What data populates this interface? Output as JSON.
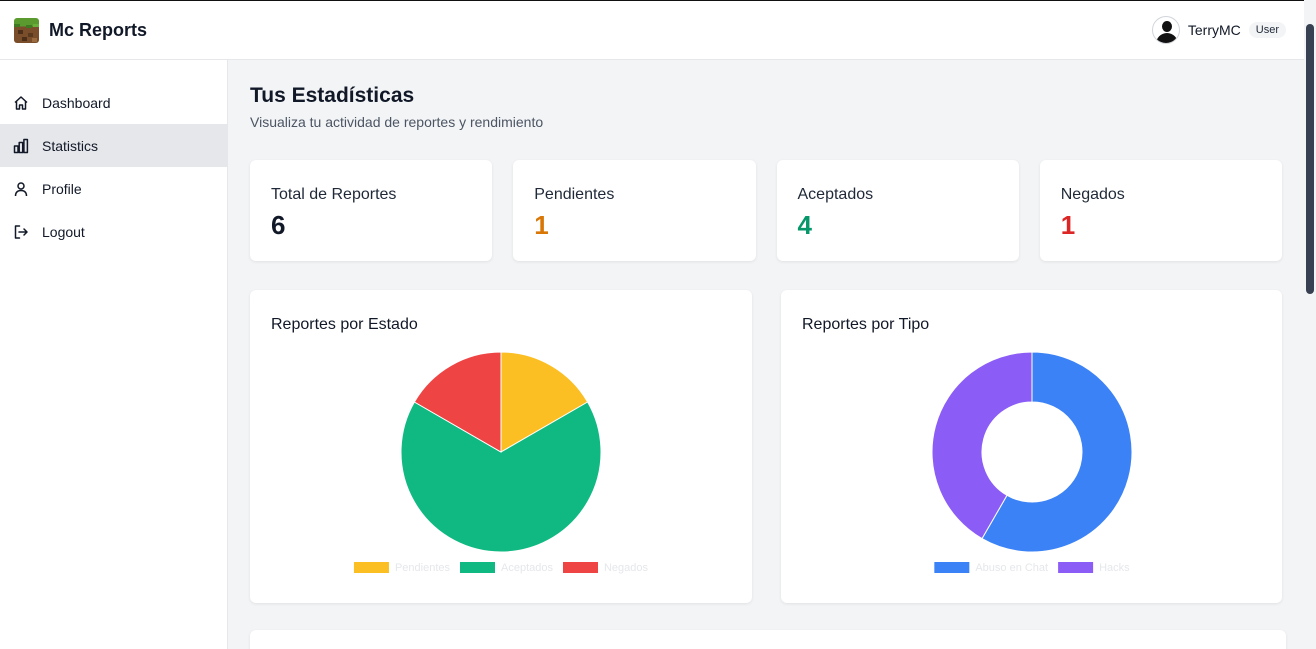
{
  "app": {
    "name": "Mc Reports"
  },
  "user": {
    "name": "TerryMC",
    "role": "User"
  },
  "sidebar": {
    "items": [
      {
        "label": "Dashboard",
        "icon": "home-icon",
        "active": false
      },
      {
        "label": "Statistics",
        "icon": "bar-chart-icon",
        "active": true
      },
      {
        "label": "Profile",
        "icon": "user-icon",
        "active": false
      },
      {
        "label": "Logout",
        "icon": "logout-icon",
        "active": false
      }
    ]
  },
  "page": {
    "title": "Tus Estadísticas",
    "subtitle": "Visualiza tu actividad de reportes y rendimiento"
  },
  "stats": [
    {
      "label": "Total de Reportes",
      "value": "6",
      "color": "#111827"
    },
    {
      "label": "Pendientes",
      "value": "1",
      "color": "#d97706"
    },
    {
      "label": "Aceptados",
      "value": "4",
      "color": "#059669"
    },
    {
      "label": "Negados",
      "value": "1",
      "color": "#dc2626"
    }
  ],
  "charts": {
    "estado": {
      "title": "Reportes por Estado"
    },
    "tipo": {
      "title": "Reportes por Tipo"
    }
  },
  "chart_data": [
    {
      "type": "pie",
      "title": "Reportes por Estado",
      "categories": [
        "Pendientes",
        "Aceptados",
        "Negados"
      ],
      "values": [
        1,
        4,
        1
      ],
      "colors": [
        "#fbbf24",
        "#10b981",
        "#ef4444"
      ],
      "legend": "bottom"
    },
    {
      "type": "pie",
      "variant": "doughnut",
      "title": "Reportes por Tipo",
      "categories": [
        "Abuso en Chat",
        "Hacks"
      ],
      "values": [
        3.5,
        2.5
      ],
      "colors": [
        "#3b82f6",
        "#8b5cf6"
      ],
      "legend": "bottom"
    }
  ]
}
